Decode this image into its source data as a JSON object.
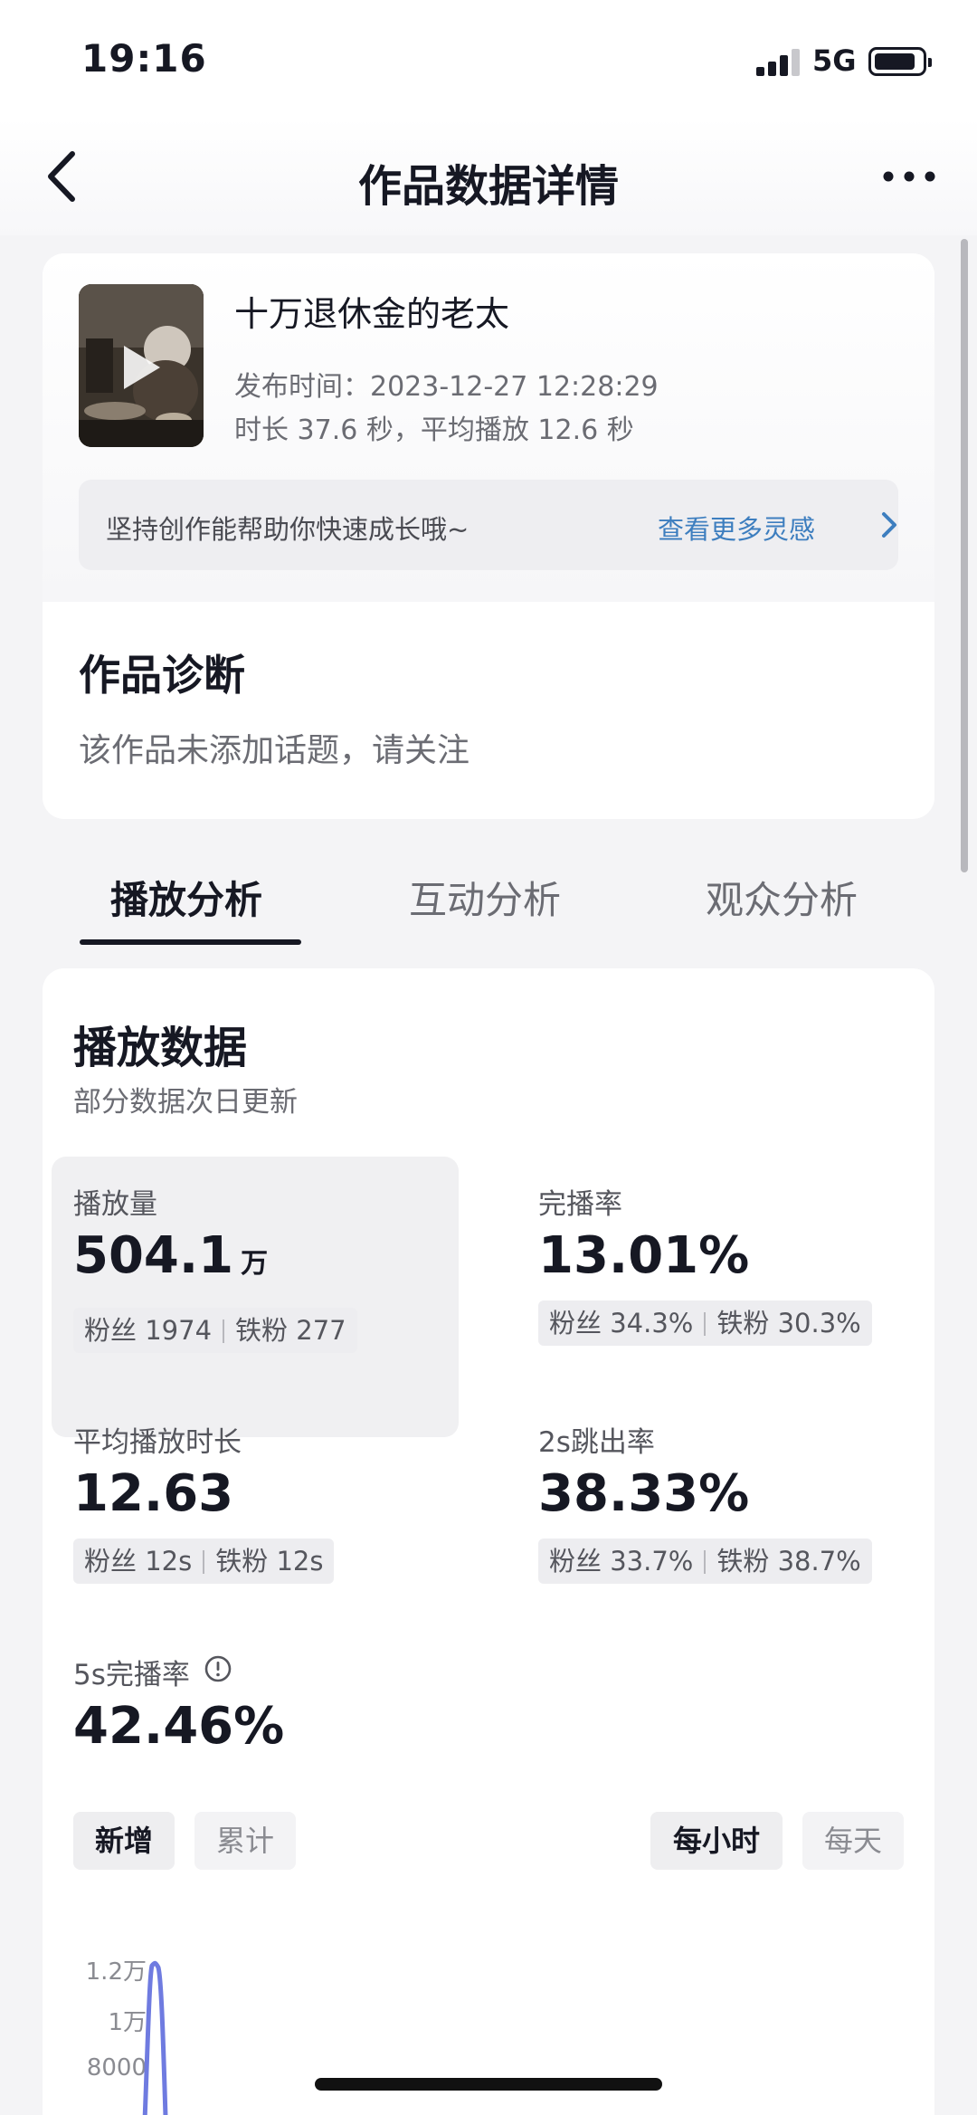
{
  "status_bar": {
    "time": "19:16",
    "network": "5G",
    "battery_level": 0.85
  },
  "nav": {
    "title": "作品数据详情",
    "back_icon": "chevron-left-icon",
    "more_icon": "more-icon"
  },
  "video": {
    "title": "十万退休金的老太",
    "publish_time": "发布时间：2023-12-27 12:28:29",
    "duration_info": "时长 37.6 秒，平均播放 12.6 秒",
    "tip_text": "坚持创作能帮助你快速成长哦~",
    "tip_link": "查看更多灵感"
  },
  "diagnosis": {
    "title": "作品诊断",
    "text": "该作品未添加话题，请关注"
  },
  "tabs": [
    {
      "label": "播放分析",
      "active": true
    },
    {
      "label": "互动分析",
      "active": false
    },
    {
      "label": "观众分析",
      "active": false
    }
  ],
  "play_data": {
    "title": "播放数据",
    "subtitle": "部分数据次日更新",
    "metrics": {
      "plays": {
        "label": "播放量",
        "value": "504.1",
        "unit": "万",
        "fans": "粉丝 1974",
        "iron_fans": "铁粉 277"
      },
      "completion": {
        "label": "完播率",
        "value": "13.01%",
        "fans": "粉丝 34.3%",
        "iron_fans": "铁粉 30.3%"
      },
      "avg_duration": {
        "label": "平均播放时长",
        "value": "12.63",
        "fans": "粉丝 12s",
        "iron_fans": "铁粉 12s"
      },
      "bounce_2s": {
        "label": "2s跳出率",
        "value": "38.33%",
        "fans": "粉丝 33.7%",
        "iron_fans": "铁粉 38.7%"
      },
      "completion_5s": {
        "label": "5s完播率",
        "value": "42.46%"
      }
    },
    "segments_left": [
      {
        "label": "新增",
        "active": true
      },
      {
        "label": "累计",
        "active": false
      }
    ],
    "segments_right": [
      {
        "label": "每小时",
        "active": true
      },
      {
        "label": "每天",
        "active": false
      }
    ]
  },
  "chart_data": {
    "type": "line",
    "y_ticks": [
      "1.2万",
      "1万",
      "8000"
    ],
    "series_color": "#6f7be0",
    "note": "partially visible; peak near 1.2万 shortly after start"
  }
}
